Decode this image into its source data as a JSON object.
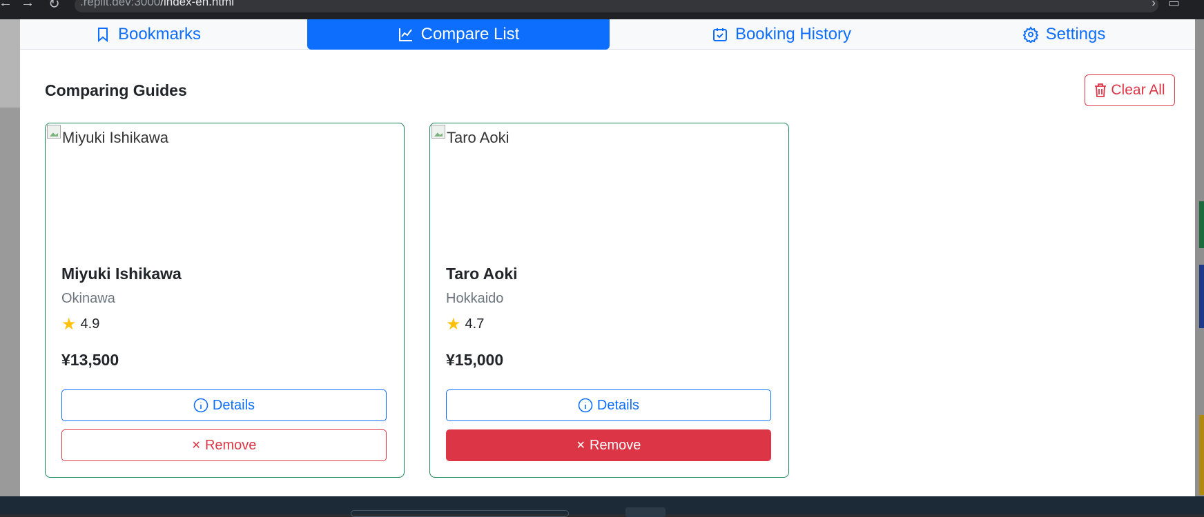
{
  "browser": {
    "url_host": ".replit.dev:3000",
    "url_path": "/index-en.html"
  },
  "tabs": [
    {
      "label": "Bookmarks",
      "icon": "bookmark-icon",
      "active": false
    },
    {
      "label": "Compare List",
      "icon": "chart-line-icon",
      "active": true
    },
    {
      "label": "Booking History",
      "icon": "calendar-check-icon",
      "active": false
    },
    {
      "label": "Settings",
      "icon": "gear-icon",
      "active": false
    }
  ],
  "section": {
    "title": "Comparing Guides",
    "clear_label": "Clear All"
  },
  "guides": [
    {
      "image_alt": "Miyuki Ishikawa",
      "name": "Miyuki Ishikawa",
      "region": "Okinawa",
      "rating": "4.9",
      "price": "¥13,500",
      "details_label": "Details",
      "remove_label": "Remove"
    },
    {
      "image_alt": "Taro Aoki",
      "name": "Taro Aoki",
      "region": "Hokkaido",
      "rating": "4.7",
      "price": "¥15,000",
      "details_label": "Details",
      "remove_label": "Remove"
    }
  ],
  "colors": {
    "primary": "#0d6efd",
    "danger": "#dc3545",
    "success_border": "#198754",
    "star": "#ffc107"
  }
}
